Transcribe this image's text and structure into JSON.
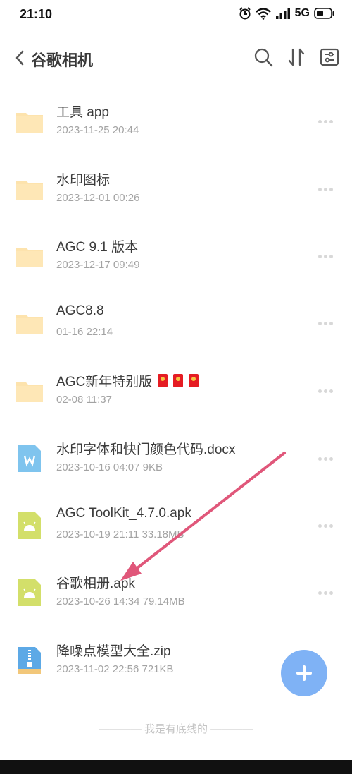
{
  "status_bar": {
    "time": "21:10",
    "network": "5G"
  },
  "header": {
    "title": "谷歌相机",
    "icons": [
      "back-icon",
      "search-icon",
      "sort-icon",
      "filter-icon"
    ]
  },
  "files": [
    {
      "name": "工具 app",
      "meta": "2023-11-25 20:44",
      "icon": "folder-icon"
    },
    {
      "name": "水印图标",
      "meta": "2023-12-01 00:26",
      "icon": "folder-icon"
    },
    {
      "name": "AGC 9.1 版本",
      "meta": "2023-12-17 09:49",
      "icon": "folder-icon"
    },
    {
      "name": "AGC8.8",
      "meta": "01-16 22:14",
      "icon": "folder-icon"
    },
    {
      "name": "AGC新年特别版",
      "meta": "02-08 11:37",
      "icon": "folder-icon"
    },
    {
      "name": "水印字体和快门颜色代码.docx",
      "meta": "2023-10-16 04:07   9KB",
      "icon": "docx-icon"
    },
    {
      "name": "AGC ToolKit_4.7.0.apk",
      "meta": "2023-10-19 21:11   33.18MB",
      "icon": "apk-icon"
    },
    {
      "name": "谷歌相册.apk",
      "meta": "2023-10-26 14:34   79.14MB",
      "icon": "apk-icon"
    },
    {
      "name": "降噪点模型大全.zip",
      "meta": "2023-11-02 22:56   721KB",
      "icon": "zip-icon"
    }
  ],
  "footer": "———— 我是有底线的 ————",
  "colors": {
    "folder": "#fde3ad",
    "docx": "#7fc4ee",
    "apk": "#d3df6a",
    "zip": "#5da9e6",
    "fab": "#7fb2f5",
    "arrow": "#e0577a"
  }
}
